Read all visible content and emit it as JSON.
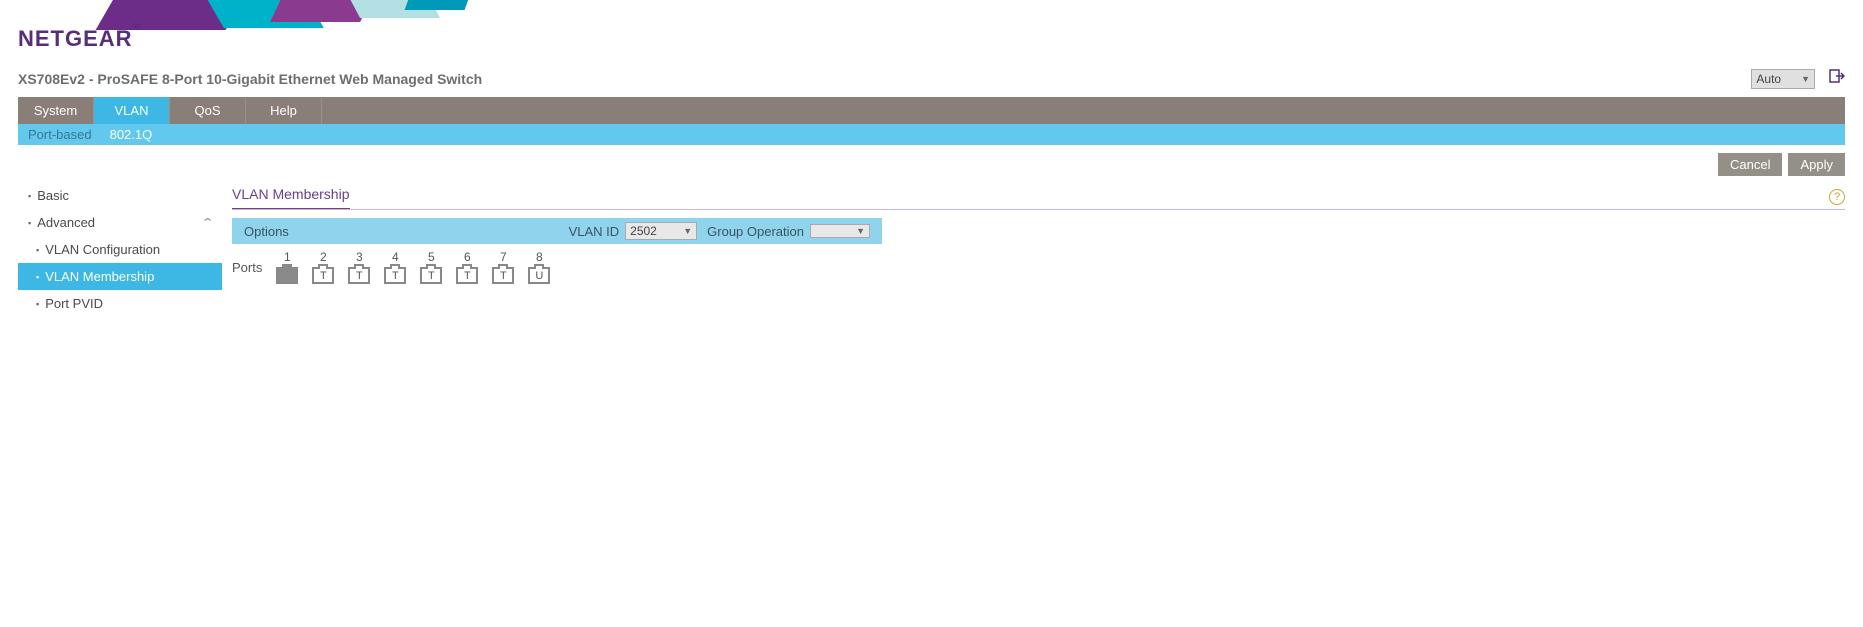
{
  "brand": "NETGEAR",
  "page_title": "XS708Ev2 - ProSAFE 8-Port 10-Gigabit Ethernet Web Managed Switch",
  "auto_select": {
    "label": "Auto"
  },
  "main_tabs": [
    "System",
    "VLAN",
    "QoS",
    "Help"
  ],
  "main_tab_active": "VLAN",
  "sub_tabs": [
    "Port-based",
    "802.1Q"
  ],
  "sub_tab_active": "802.1Q",
  "buttons": {
    "cancel": "Cancel",
    "apply": "Apply"
  },
  "sidebar": {
    "items": [
      {
        "label": "Basic",
        "level": 0
      },
      {
        "label": "Advanced",
        "level": 0,
        "expandable": true
      },
      {
        "label": "VLAN Configuration",
        "level": 1
      },
      {
        "label": "VLAN Membership",
        "level": 1,
        "active": true
      },
      {
        "label": "Port PVID",
        "level": 1
      }
    ]
  },
  "section_title": "VLAN Membership",
  "options": {
    "label": "Options",
    "vlan_id_label": "VLAN ID",
    "vlan_id_value": "2502",
    "group_op_label": "Group Operation",
    "group_op_value": ""
  },
  "ports": {
    "label": "Ports",
    "list": [
      {
        "num": "1",
        "tag": ""
      },
      {
        "num": "2",
        "tag": "T"
      },
      {
        "num": "3",
        "tag": "T"
      },
      {
        "num": "4",
        "tag": "T"
      },
      {
        "num": "5",
        "tag": "T"
      },
      {
        "num": "6",
        "tag": "T"
      },
      {
        "num": "7",
        "tag": "T"
      },
      {
        "num": "8",
        "tag": "U"
      }
    ]
  }
}
